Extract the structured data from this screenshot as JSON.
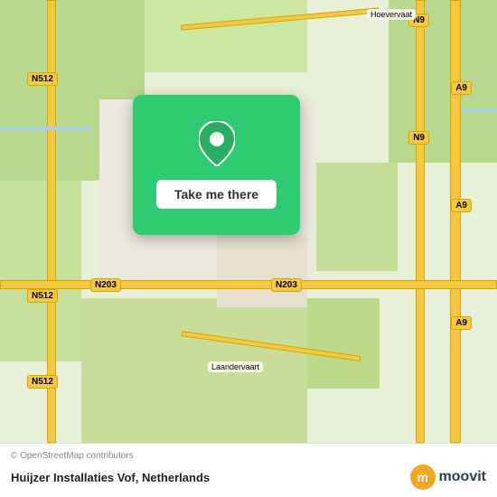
{
  "map": {
    "attribution": "© OpenStreetMap contributors",
    "popup": {
      "button_label": "Take me there"
    },
    "road_labels": {
      "n512_top": "N512",
      "n512_mid": "N512",
      "n512_bot": "N512",
      "n9_top": "N9",
      "n9_right": "N9",
      "a9_top": "A9",
      "a9_mid": "A9",
      "a9_bot": "A9",
      "n203_left": "N203",
      "n203_right": "N203",
      "hoevervaat": "Hoevervaat",
      "laandervaart": "Laandervaart"
    }
  },
  "footer": {
    "copyright": "© OpenStreetMap contributors",
    "location_name": "Huijzer Installaties Vof,",
    "country": "Netherlands",
    "logo_letter": "m",
    "logo_text": "moovit"
  }
}
